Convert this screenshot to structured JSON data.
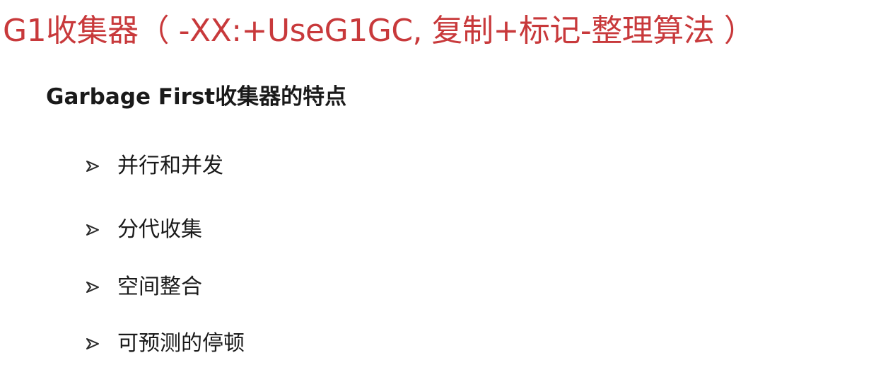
{
  "slide": {
    "title": "G1收集器（ -XX:+UseG1GC, 复制+标记-整理算法 ）",
    "subtitle": "Garbage First收集器的特点",
    "bullets": [
      {
        "icon": "arrowhead-bullet-icon",
        "label": "并行和并发"
      },
      {
        "icon": "arrowhead-bullet-icon",
        "label": "分代收集"
      },
      {
        "icon": "arrowhead-bullet-icon",
        "label": "空间整合"
      },
      {
        "icon": "arrowhead-bullet-icon",
        "label": "可预测的停顿"
      }
    ]
  },
  "colors": {
    "title": "#c8393b",
    "text": "#1a1a1a",
    "bullet": "#2a2a2a",
    "background": "#ffffff"
  }
}
